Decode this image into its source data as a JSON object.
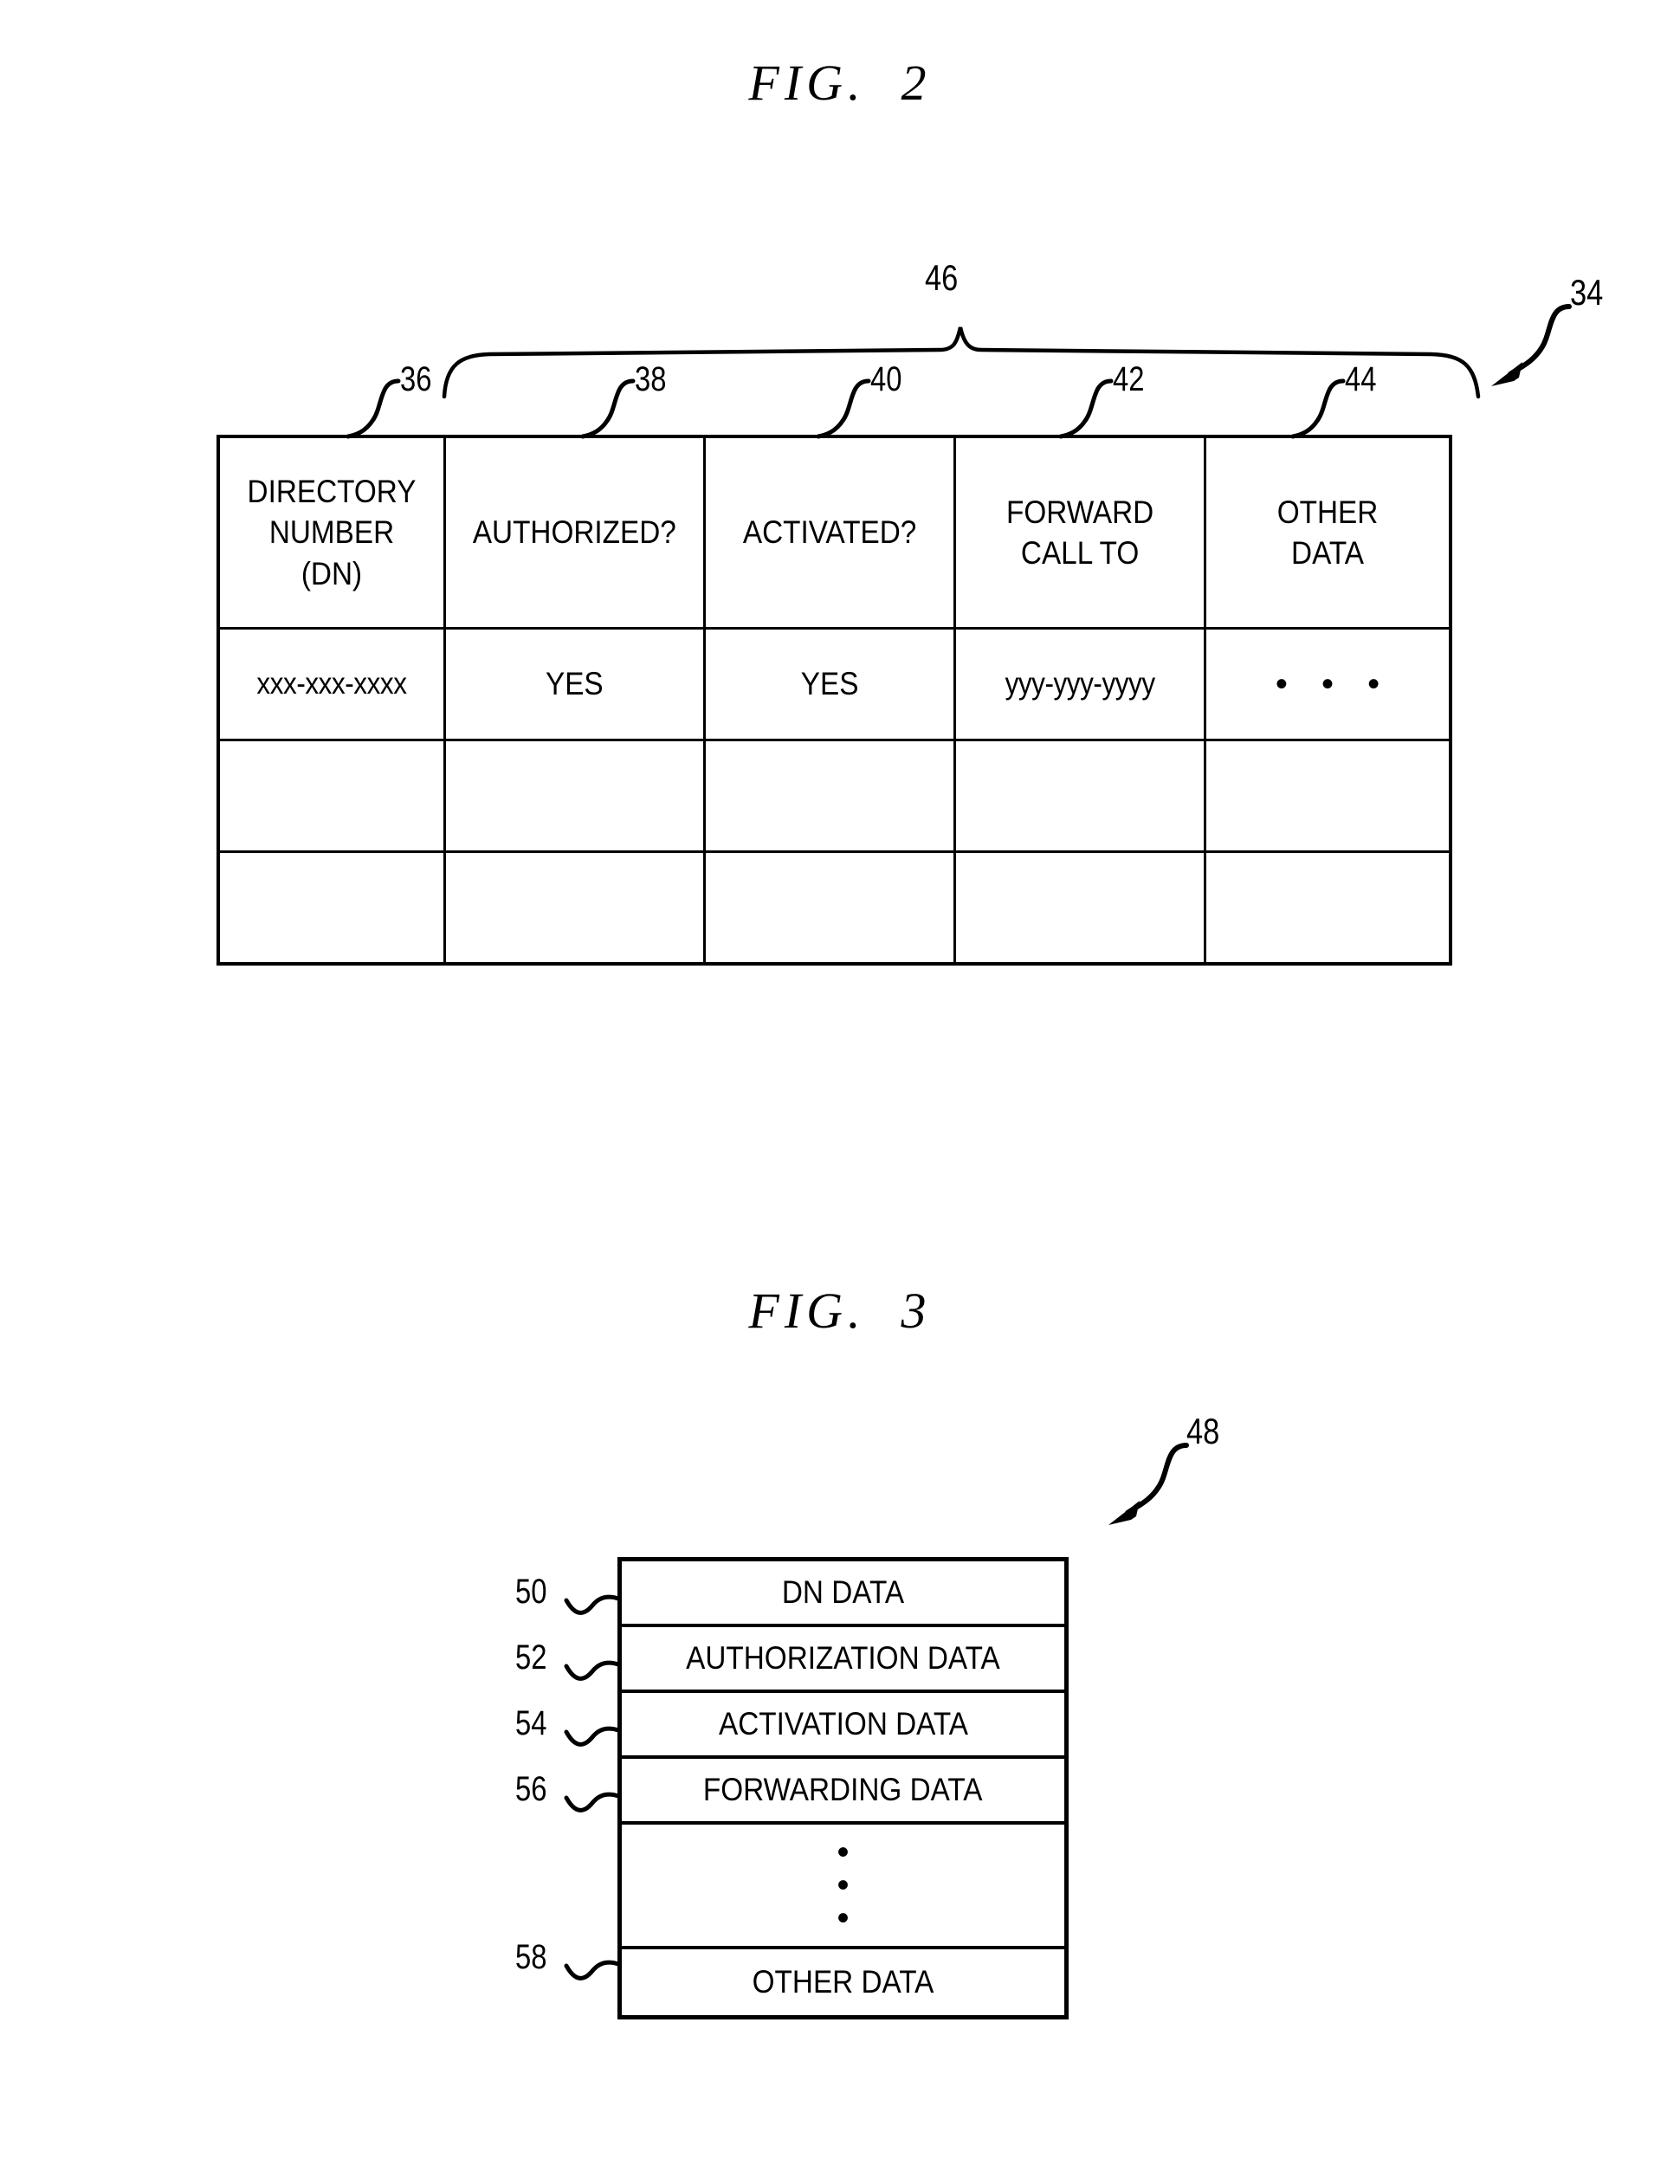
{
  "fig2": {
    "title": "FIG.  2",
    "diagram_ref": "34",
    "group_brace_ref": "46",
    "column_refs": [
      "36",
      "38",
      "40",
      "42",
      "44"
    ],
    "table": {
      "headers": [
        "DIRECTORY\nNUMBER\n(DN)",
        "AUTHORIZED?",
        "ACTIVATED?",
        "FORWARD\nCALL TO",
        "OTHER\nDATA"
      ],
      "rows": [
        [
          "xxx-xxx-xxxx",
          "YES",
          "YES",
          "yyy-yyy-yyyy",
          "•  •  •"
        ],
        [
          "",
          "",
          "",
          "",
          ""
        ],
        [
          "",
          "",
          "",
          "",
          ""
        ]
      ]
    }
  },
  "fig3": {
    "title": "FIG.  3",
    "diagram_ref": "48",
    "rows": [
      {
        "ref": "50",
        "label": "DN DATA"
      },
      {
        "ref": "52",
        "label": "AUTHORIZATION DATA"
      },
      {
        "ref": "54",
        "label": "ACTIVATION DATA"
      },
      {
        "ref": "56",
        "label": "FORWARDING DATA"
      },
      {
        "ref": "",
        "label": "•\n•\n•"
      },
      {
        "ref": "58",
        "label": "OTHER DATA"
      }
    ]
  },
  "colors": {
    "ink": "#000000",
    "paper": "#ffffff"
  }
}
